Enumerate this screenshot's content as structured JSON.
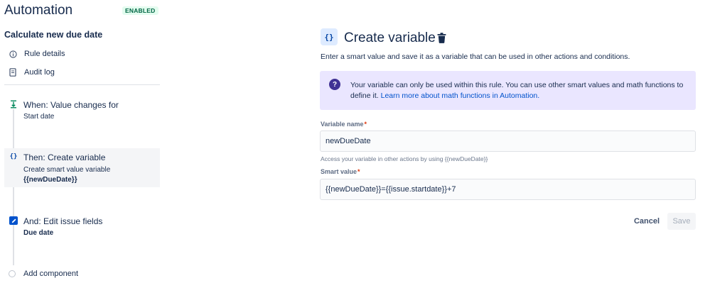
{
  "app": {
    "title": "Automation",
    "status_badge": "ENABLED"
  },
  "rule": {
    "name": "Calculate new due date"
  },
  "sidebar": {
    "items": [
      {
        "label": "Rule details",
        "icon": "info-icon"
      },
      {
        "label": "Audit log",
        "icon": "document-icon"
      }
    ]
  },
  "steps": [
    {
      "title": "When: Value changes for",
      "line1": "Start date",
      "line2": "",
      "icon": "trigger-icon",
      "icon_color": "#00875a"
    },
    {
      "title": "Then: Create variable",
      "line1": "Create smart value variable",
      "line2": "{{newDueDate}}",
      "icon": "variable-icon",
      "icon_color": "#0747a6",
      "selected": true
    },
    {
      "title": "And: Edit issue fields",
      "line1": "Due date",
      "line2": "",
      "icon": "edit-icon",
      "icon_color": "#0052cc"
    }
  ],
  "add_component": {
    "label": "Add component"
  },
  "panel": {
    "title": "Create variable",
    "icon_text": "{}",
    "description": "Enter a smart value and save it as a variable that can be used in other actions and conditions.",
    "info": {
      "text": "Your variable can only be used within this rule. You can use other smart values and math functions to define it.",
      "link": "Learn more about math functions in Automation."
    },
    "variable_name": {
      "label": "Variable name",
      "required_mark": "*",
      "value": "newDueDate",
      "helper": "Access your variable in other actions by using {{newDueDate}}"
    },
    "smart_value": {
      "label": "Smart value",
      "required_mark": "*",
      "value": "{{newDueDate}}={{issue.startdate}}+7"
    },
    "cancel_label": "Cancel",
    "save_label": "Save"
  },
  "colors": {
    "enabled_badge_bg": "#e3fcef",
    "enabled_badge_text": "#006644",
    "info_bg": "#eae6ff",
    "info_icon": "#403294",
    "link": "#0052cc"
  }
}
